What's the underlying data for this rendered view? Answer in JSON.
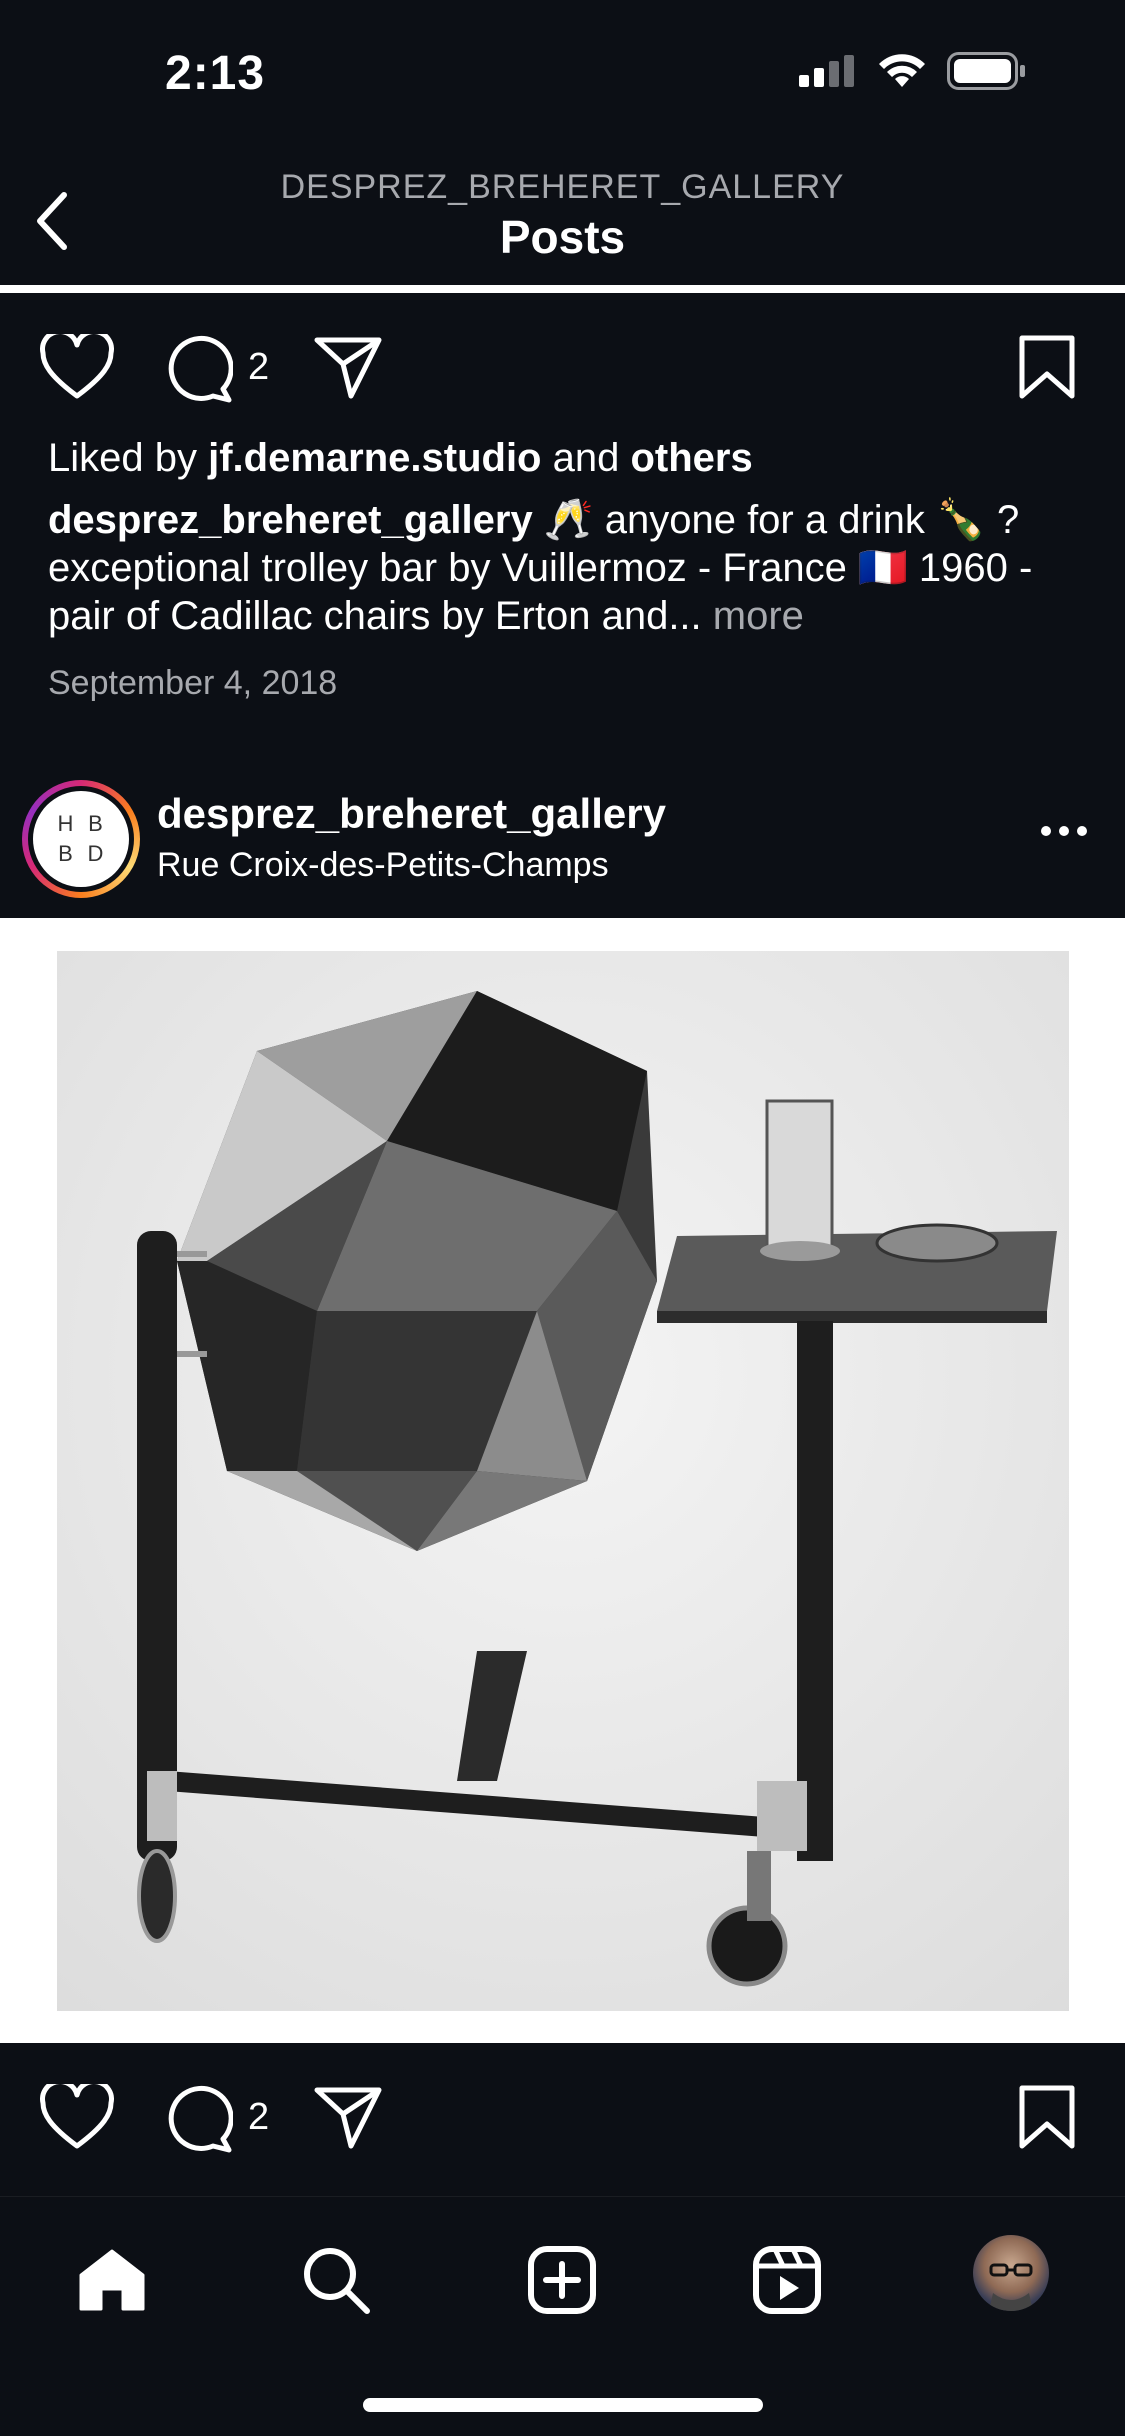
{
  "status_bar": {
    "time": "2:13",
    "icons": [
      "signal-icon",
      "wifi-icon",
      "battery-icon"
    ]
  },
  "header": {
    "subtitle": "DESPREZ_BREHERET_GALLERY",
    "title": "Posts",
    "back_icon": "chevron-left-icon"
  },
  "post_prev": {
    "comment_count": "2",
    "liked_prefix": "Liked by ",
    "liked_user": "jf.demarne.studio",
    "liked_and": " and ",
    "liked_others": "others",
    "caption_user": "desprez_breheret_gallery",
    "caption_text": " 🥂 anyone for a drink 🍾 ? exceptional trolley bar by Vuillermoz - France 🇫🇷 1960 - pair of Cadillac chairs by Erton and... ",
    "caption_more": "more",
    "date": "September 4, 2018"
  },
  "post": {
    "username": "desprez_breheret_gallery",
    "location": "Rue Croix-des-Petits-Champs",
    "avatar_letters": [
      "H",
      "B",
      "B",
      "D"
    ],
    "comment_count": "2",
    "image_alt": "trolley-bar-photo"
  },
  "tab_bar": {
    "items": [
      "home-icon",
      "search-icon",
      "create-icon",
      "reels-icon",
      "profile-avatar"
    ]
  },
  "colors": {
    "background": "#0c0f15",
    "text": "#ffffff",
    "muted": "#a7a9ae",
    "image_bg": "#ffffff"
  }
}
